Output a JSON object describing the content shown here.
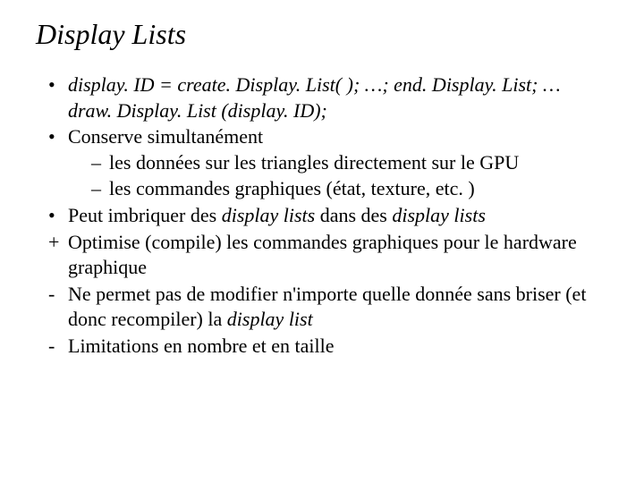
{
  "title": "Display Lists",
  "bullets": {
    "b1": {
      "marker": "•",
      "text_italic": "display. ID = create. Display. List( ); …; end. Display. List; … draw. Display. List (display. ID);"
    },
    "b2": {
      "marker": "•",
      "text": "Conserve simultanément",
      "sub": [
        {
          "marker": "–",
          "text": "les données sur les triangles directement sur le GPU"
        },
        {
          "marker": "–",
          "text": "les commandes graphiques (état, texture, etc. )"
        }
      ]
    },
    "b3": {
      "marker": "•",
      "pre": "Peut imbriquer des ",
      "em1": "display lists",
      "mid": " dans des ",
      "em2": "display lists"
    },
    "b4": {
      "marker": "+",
      "text": "Optimise (compile) les commandes graphiques pour le hardware graphique"
    },
    "b5": {
      "marker": "-",
      "pre": "Ne permet pas de modifier n'importe quelle donnée sans briser (et donc recompiler) la ",
      "em1": "display list"
    },
    "b6": {
      "marker": "-",
      "text": "Limitations en nombre et en taille"
    }
  }
}
